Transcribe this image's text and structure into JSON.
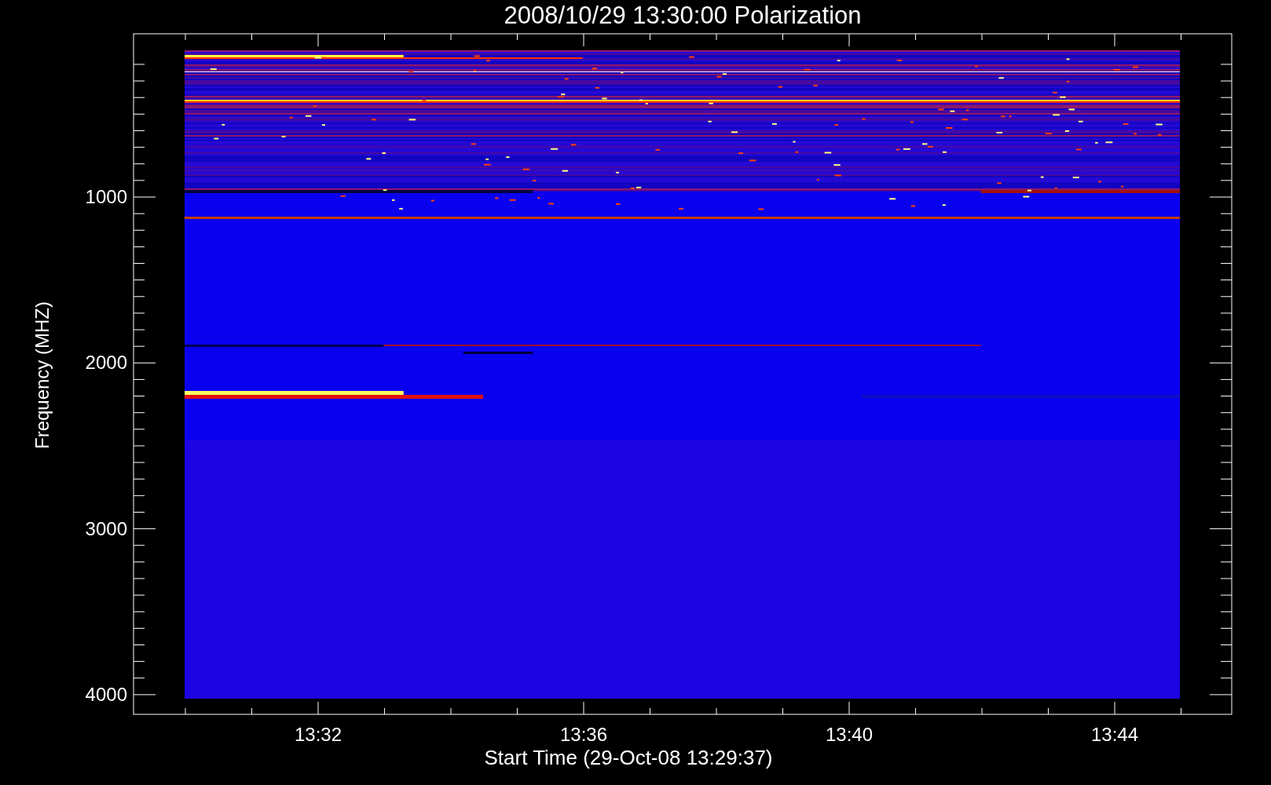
{
  "title": "2008/10/29 13:30:00 Polarization",
  "y_axis": {
    "label": "Frequency (MHZ)",
    "ticks": [
      "1000",
      "2000",
      "3000",
      "4000"
    ]
  },
  "x_axis": {
    "label": "Start Time (29-Oct-08 13:29:37)",
    "ticks": [
      "13:32",
      "13:36",
      "13:40",
      "13:44"
    ]
  }
}
